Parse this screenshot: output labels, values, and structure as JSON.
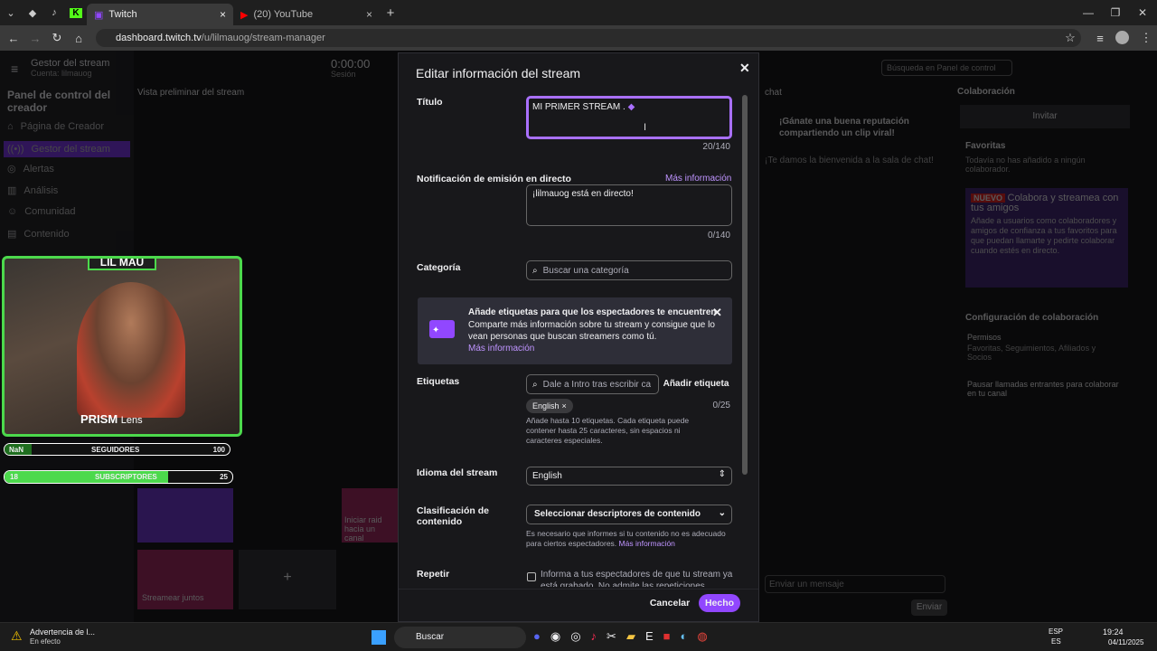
{
  "browser": {
    "tabs": [
      {
        "title": "Twitch",
        "active": true
      },
      {
        "title": "(20) YouTube",
        "active": false
      }
    ],
    "url_host": "dashboard.twitch.tv",
    "url_path": "/u/lilmauog/stream-manager"
  },
  "background": {
    "channel": "Gestor del stream",
    "channel_sub": "Cuenta: lilmauog",
    "time": "0:00:00",
    "time_label": "Sesión",
    "search_placeholder": "Búsqueda en Panel de control",
    "sidebar_title": "Panel de control del creador",
    "sidebar_items": [
      "Página de Creador",
      "Gestor del stream",
      "Alertas",
      "Análisis",
      "Comunidad",
      "Contenido"
    ],
    "preview_label": "Vista preliminar del stream",
    "chat_label": "chat",
    "chat_tip": "¡Gánate una buena reputación compartiendo un clip viral!",
    "chat_welcome": "¡Te damos la bienvenida a la sala de chat!",
    "collab_label": "Colaboración",
    "invite": "Invitar",
    "favorites": "Favoritas",
    "favorites_empty": "Todavía no has añadido a ningún colaborador.",
    "new_badge": "NUEVO",
    "promo_title": "Colabora y streamea con tus amigos",
    "promo_text": "Añade a usuarios como colaboradores y amigos de confianza a tus favoritos para que puedan llamarte y pedirte colaborar cuando estés en directo.",
    "collab_config": "Configuración de colaboración",
    "permisos": "Permisos",
    "permisos_sub": "Favoritas, Seguimientos, Afiliados y Socios",
    "pause_calls": "Pausar llamadas entrantes para colaborar en tu canal",
    "chat_placeholder": "Enviar un mensaje",
    "send": "Enviar",
    "raid": "Iniciar raid hacia un canal",
    "together": "Streamear juntos"
  },
  "overlay": {
    "name": "LIL MAU",
    "brand": "PRISM",
    "brand_light": "Lens",
    "followers_label": "SEGUIDORES",
    "followers_left": "NaN",
    "followers_right": "100",
    "subs_label": "SUBSCRIPTORES",
    "subs_left": "18",
    "subs_right": "25",
    "subs_fill": 0.72
  },
  "modal": {
    "title": "Editar información del stream",
    "title_label": "Título",
    "title_value": "MI PRIMER STREAM .",
    "title_counter": "20/140",
    "notif_label": "Notificación de emisión en directo",
    "notif_more": "Más información",
    "notif_placeholder": "¡lilmauog está en directo!",
    "notif_counter": "0/140",
    "category_label": "Categoría",
    "category_placeholder": "Buscar una categoría",
    "banner_title": "Añade etiquetas para que los espectadores te encuentren",
    "banner_text": "Comparte más información sobre tu stream y consigue que lo vean personas que buscan streamers como tú.",
    "banner_link": "Más información",
    "tags_label": "Etiquetas",
    "tags_placeholder": "Dale a Intro tras escribir ca",
    "add_tag": "Añadir etiqueta",
    "tags_counter": "0/25",
    "tag_chip": "English",
    "tags_help": "Añade hasta 10 etiquetas. Cada etiqueta puede contener hasta 25 caracteres, sin espacios ni caracteres especiales.",
    "lang_label": "Idioma del stream",
    "lang_value": "English",
    "class_label1": "Clasificación de",
    "class_label2": "contenido",
    "class_value": "Seleccionar descriptores de contenido",
    "class_help": "Es necesario que informes si tu contenido no es adecuado para ciertos espectadores.",
    "class_help_link": "Más información",
    "repeat_label": "Repetir",
    "repeat_text": "Informa a tus espectadores de que tu stream ya está grabado. No admite las repeticiones",
    "cancel": "Cancelar",
    "done": "Hecho"
  },
  "taskbar": {
    "alert_title": "Advertencia de l...",
    "alert_sub": "En efecto",
    "search": "Buscar",
    "lang1": "ESP",
    "lang2": "ES",
    "time": "19:24",
    "date": "04/11/2025"
  },
  "colors": {
    "accent": "#9147ff",
    "link": "#bf94ff",
    "overlay_green": "#4cd94c"
  }
}
